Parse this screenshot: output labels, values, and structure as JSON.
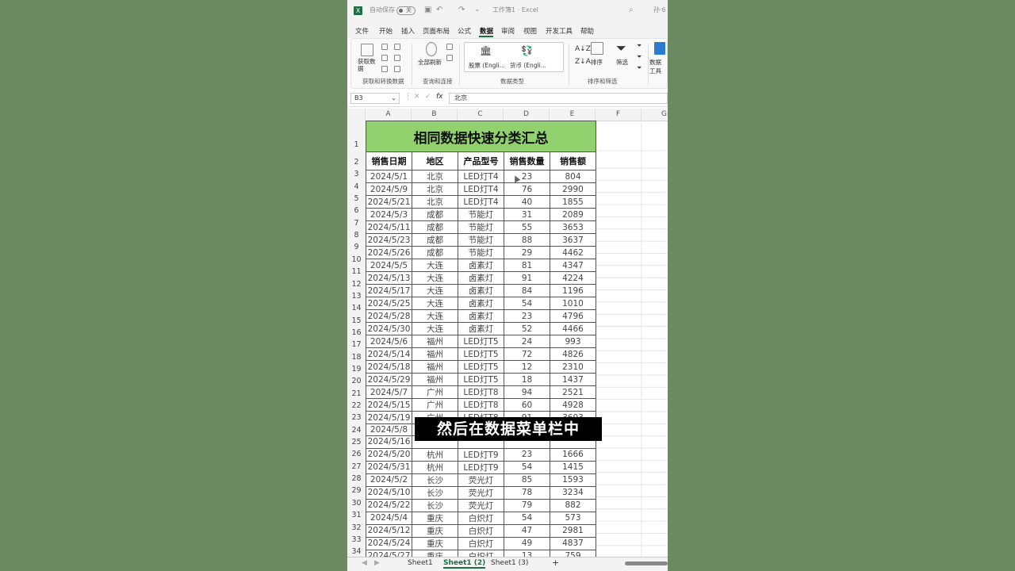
{
  "titlebar": {
    "autosave_label": "自动保存",
    "autosave_state": "关",
    "file_title": "工作簿1 · Excel",
    "user_initials": "孙·6"
  },
  "menu": {
    "items": [
      "文件",
      "开始",
      "插入",
      "页面布局",
      "公式",
      "数据",
      "审阅",
      "视图",
      "开发工具",
      "帮助"
    ],
    "active": "数据"
  },
  "ribbon": {
    "get_data": "获取数\n据",
    "refresh_all": "全部刷新",
    "stocks": "股票 (Engli...",
    "currency": "货币 (Engli...",
    "sort": "排序",
    "filter": "筛选",
    "data_tools": "数据工具",
    "groups": [
      "获取和转换数据",
      "查询和连接",
      "数据类型",
      "排序和筛选"
    ]
  },
  "formula_bar": {
    "cell_ref": "B3",
    "fx": "fx",
    "content": "北京"
  },
  "columns": [
    "A",
    "B",
    "C",
    "D",
    "E",
    "F",
    "G"
  ],
  "sheet": {
    "title": "相同数据快速分类汇总",
    "headers": [
      "销售日期",
      "地区",
      "产品型号",
      "销售数量",
      "销售额"
    ],
    "rows": [
      [
        "2024/5/1",
        "北京",
        "LED灯T4",
        "23",
        "804"
      ],
      [
        "2024/5/9",
        "北京",
        "LED灯T4",
        "76",
        "2990"
      ],
      [
        "2024/5/21",
        "北京",
        "LED灯T4",
        "40",
        "1855"
      ],
      [
        "2024/5/3",
        "成都",
        "节能灯",
        "31",
        "2089"
      ],
      [
        "2024/5/11",
        "成都",
        "节能灯",
        "55",
        "3653"
      ],
      [
        "2024/5/23",
        "成都",
        "节能灯",
        "88",
        "3637"
      ],
      [
        "2024/5/26",
        "成都",
        "节能灯",
        "29",
        "4462"
      ],
      [
        "2024/5/5",
        "大连",
        "卤素灯",
        "81",
        "4347"
      ],
      [
        "2024/5/13",
        "大连",
        "卤素灯",
        "91",
        "4224"
      ],
      [
        "2024/5/17",
        "大连",
        "卤素灯",
        "84",
        "1196"
      ],
      [
        "2024/5/25",
        "大连",
        "卤素灯",
        "54",
        "1010"
      ],
      [
        "2024/5/28",
        "大连",
        "卤素灯",
        "23",
        "4796"
      ],
      [
        "2024/5/30",
        "大连",
        "卤素灯",
        "52",
        "4466"
      ],
      [
        "2024/5/6",
        "福州",
        "LED灯T5",
        "24",
        "993"
      ],
      [
        "2024/5/14",
        "福州",
        "LED灯T5",
        "72",
        "4826"
      ],
      [
        "2024/5/18",
        "福州",
        "LED灯T5",
        "12",
        "2310"
      ],
      [
        "2024/5/29",
        "福州",
        "LED灯T5",
        "18",
        "1437"
      ],
      [
        "2024/5/7",
        "广州",
        "LED灯T8",
        "94",
        "2521"
      ],
      [
        "2024/5/15",
        "广州",
        "LED灯T8",
        "60",
        "4928"
      ],
      [
        "2024/5/19",
        "广州",
        "LED灯T8",
        "91",
        "3603"
      ],
      [
        "2024/5/8",
        "",
        "",
        "",
        ""
      ],
      [
        "2024/5/16",
        "",
        "",
        "",
        ""
      ],
      [
        "2024/5/20",
        "杭州",
        "LED灯T9",
        "23",
        "1666"
      ],
      [
        "2024/5/31",
        "杭州",
        "LED灯T9",
        "54",
        "1415"
      ],
      [
        "2024/5/2",
        "长沙",
        "荧光灯",
        "85",
        "1593"
      ],
      [
        "2024/5/10",
        "长沙",
        "荧光灯",
        "78",
        "3234"
      ],
      [
        "2024/5/22",
        "长沙",
        "荧光灯",
        "79",
        "882"
      ],
      [
        "2024/5/4",
        "重庆",
        "白炽灯",
        "54",
        "573"
      ],
      [
        "2024/5/12",
        "重庆",
        "白炽灯",
        "47",
        "2981"
      ],
      [
        "2024/5/24",
        "重庆",
        "白炽灯",
        "49",
        "4837"
      ],
      [
        "2024/5/27",
        "重庆",
        "白炽灯",
        "13",
        "759"
      ]
    ]
  },
  "row_numbers": [
    "1",
    "2",
    "3",
    "4",
    "5",
    "6",
    "7",
    "8",
    "9",
    "10",
    "11",
    "12",
    "13",
    "14",
    "15",
    "16",
    "17",
    "18",
    "19",
    "20",
    "21",
    "22",
    "23",
    "24",
    "25",
    "26",
    "27",
    "28",
    "29",
    "30",
    "31",
    "32",
    "33",
    "34"
  ],
  "subtitle": "然后在数据菜单栏中",
  "tabs": {
    "items": [
      "Sheet1",
      "Sheet1 (2)",
      "Sheet1 (3)"
    ],
    "active_index": 1,
    "add": "+"
  },
  "colors": {
    "title_fill": "#92d26e",
    "background": "#6b8a62",
    "excel_green": "#1d6f42"
  }
}
